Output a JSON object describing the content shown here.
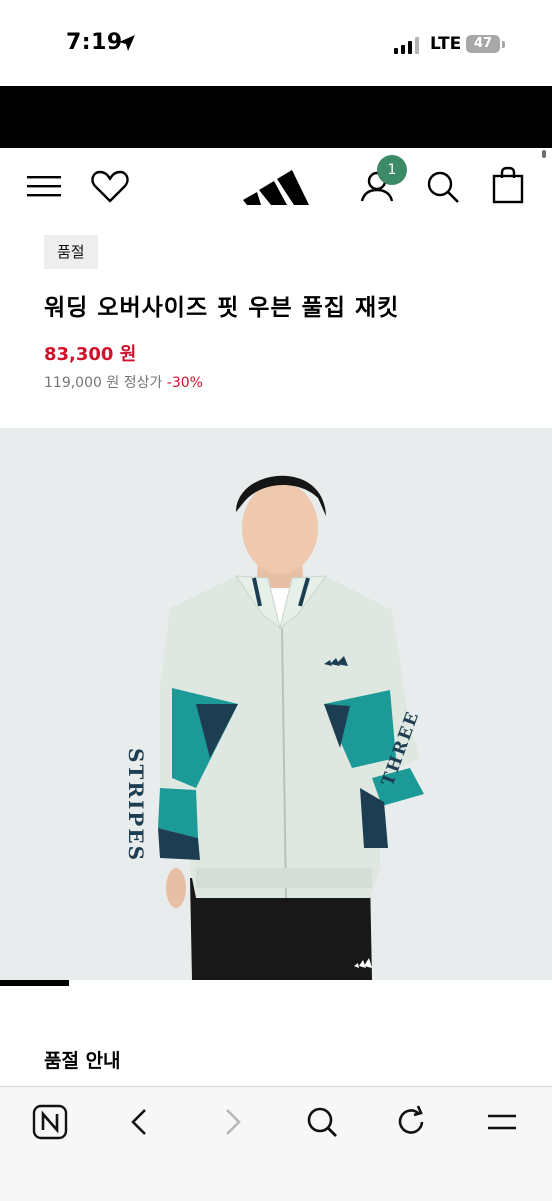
{
  "status_bar": {
    "time": "7:19",
    "network": "LTE",
    "battery": "47",
    "icons": [
      "location-arrow-icon",
      "signal-bars-icon",
      "battery-icon"
    ]
  },
  "header": {
    "icons": [
      "menu-icon",
      "wishlist-heart-icon",
      "adidas-logo",
      "account-icon",
      "search-icon",
      "shopping-bag-icon"
    ],
    "account_badge": "1"
  },
  "product": {
    "status_tag": "품절",
    "title": "워딩 오버사이즈 핏 우븐 풀집 재킷",
    "sale_price": "83,300 원",
    "original_price": "119,000 원",
    "original_price_label": "정상가",
    "discount": "-30%"
  },
  "image": {
    "alt": "product-photo",
    "sleeve_text_left": "STRIPES",
    "sleeve_text_right": "THREE"
  },
  "gallery": {
    "current": 1,
    "total": 8
  },
  "section": {
    "heading": "품절 안내"
  },
  "browser_toolbar": {
    "icons": [
      "naver-n-icon",
      "back-icon",
      "forward-icon",
      "search-icon",
      "reload-icon",
      "menu-icon"
    ]
  },
  "colors": {
    "sale_red": "#d0112b",
    "badge_green": "#3c8b66",
    "image_bg": "#e9ecec",
    "jacket_mint": "#dfe8e0",
    "jacket_teal": "#1b9a98",
    "jacket_navy": "#1d3d52"
  }
}
